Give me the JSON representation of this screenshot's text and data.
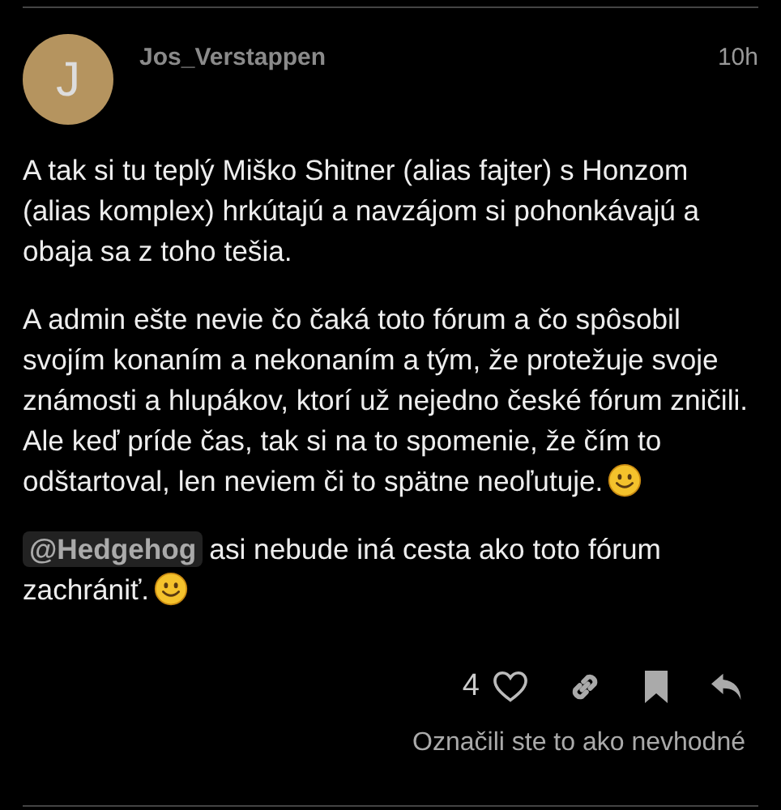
{
  "post": {
    "avatar_letter": "J",
    "username": "Jos_Verstappen",
    "time": "10h",
    "paragraphs": [
      {
        "text": "A tak si tu teplý Miško Shitner (alias fajter) s Honzom (alias komplex) hrkútajú a navzájom si pohonkávajú a obaja sa z toho tešia.",
        "trailing_emoji": false
      },
      {
        "text": "A admin ešte nevie čo čaká toto fórum a čo spôsobil svojím konaním a nekonaním a tým, že protežuje svoje známosti a hlupákov, ktorí už nejedno české fórum zničili. Ale keď príde čas, tak si na to spomenie, že čím to odštartoval, len neviem či to spätne neoľutuje.",
        "trailing_emoji": true
      },
      {
        "mention": "@Hedgehog",
        "text": "asi nebude iná cesta ako toto fórum zachrániť.",
        "trailing_emoji": true
      }
    ],
    "like_count": "4",
    "bookmarked": true,
    "flag_notice": "Označili ste to ako nevhodné"
  }
}
